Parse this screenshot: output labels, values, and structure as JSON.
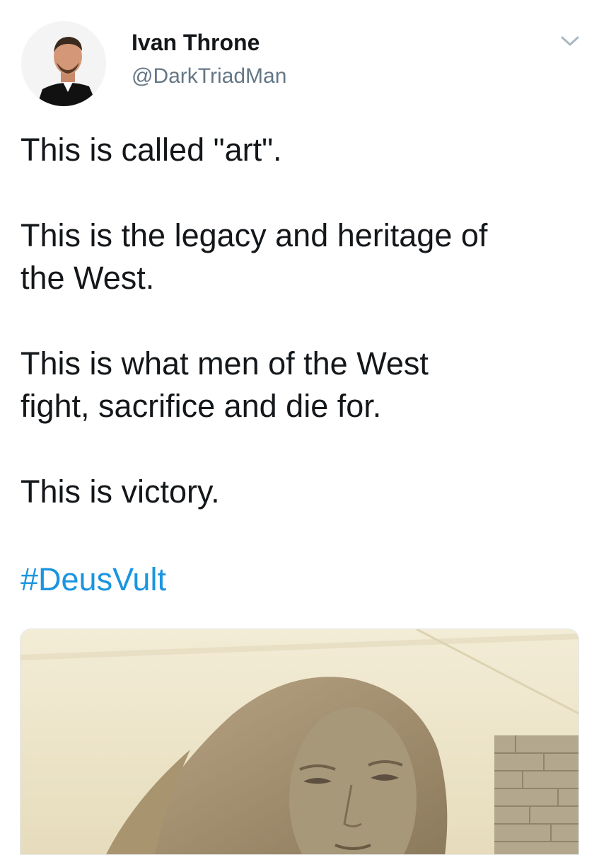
{
  "tweet": {
    "author": {
      "name": "Ivan Throne",
      "handle": "@DarkTriadMan",
      "avatar_icon": "profile-photo"
    },
    "menu_icon": "chevron-down-icon",
    "text": {
      "line1": "This is called \"art\".",
      "line2a": "This is the legacy and heritage of",
      "line2b": "the West.",
      "line3a": "This is what men of the West",
      "line3b": "fight, sacrifice and die for.",
      "line4": "This is victory."
    },
    "hashtag": "#DeusVult",
    "media": {
      "type": "photo",
      "subject": "sculpted bust"
    }
  },
  "colors": {
    "text": "#14171a",
    "secondary": "#657786",
    "link": "#1b95e0",
    "background": "#ffffff"
  }
}
